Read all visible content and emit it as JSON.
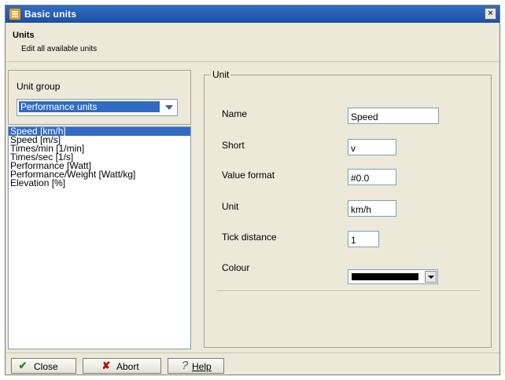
{
  "window": {
    "title": "Basic units",
    "close_glyph": "×"
  },
  "header": {
    "title": "Units",
    "subtitle": "Edit all available units"
  },
  "unit_group": {
    "label": "Unit group",
    "selected": "Performance units"
  },
  "unit_list": {
    "items": [
      "Speed [km/h]",
      "Speed [m/s]",
      "Times/min [1/min]",
      "Times/sec [1/s]",
      "Performance [Watt]",
      "Performance/Weight [Watt/kg]",
      "Elevation [%]"
    ],
    "selected_index": 0
  },
  "unit_form": {
    "legend": "Unit",
    "fields": {
      "name": {
        "label": "Name",
        "value": "Speed"
      },
      "short": {
        "label": "Short",
        "value": "v"
      },
      "value_format": {
        "label": "Value format",
        "value": "#0.0"
      },
      "unit": {
        "label": "Unit",
        "value": "km/h"
      },
      "tick_distance": {
        "label": "Tick distance",
        "value": "1"
      },
      "colour": {
        "label": "Colour",
        "value": "#000000"
      }
    }
  },
  "buttons": {
    "close": "Close",
    "abort": "Abort",
    "help": "Help"
  },
  "icons": {
    "close": "checkmark-icon",
    "abort": "x-icon",
    "help": "question-icon"
  },
  "colors": {
    "titlebar": "#1c4fa4",
    "selection": "#316ac5",
    "panel": "#ece9d8",
    "close_check": "#1e8a1e",
    "abort_x": "#c00000"
  }
}
